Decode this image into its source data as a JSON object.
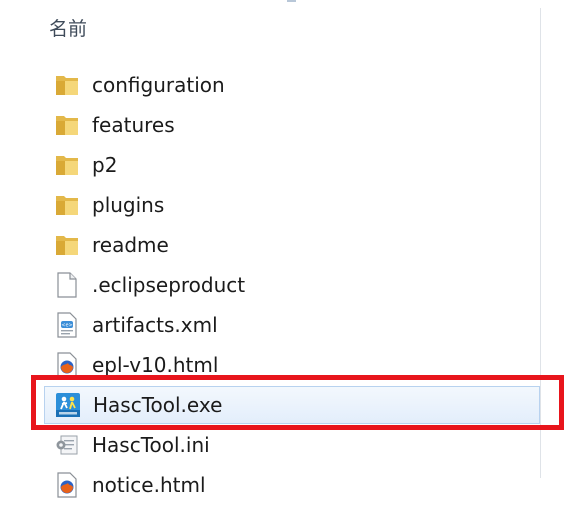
{
  "column_header": "名前",
  "files": [
    {
      "name": "configuration",
      "icon": "folder-icon"
    },
    {
      "name": "features",
      "icon": "folder-icon"
    },
    {
      "name": "p2",
      "icon": "folder-icon"
    },
    {
      "name": "plugins",
      "icon": "folder-icon"
    },
    {
      "name": "readme",
      "icon": "folder-icon"
    },
    {
      "name": ".eclipseproduct",
      "icon": "blank-file-icon"
    },
    {
      "name": "artifacts.xml",
      "icon": "xml-file-icon"
    },
    {
      "name": "epl-v10.html",
      "icon": "html-file-icon"
    },
    {
      "name": "HascTool.exe",
      "icon": "exe-app-icon",
      "selected": true
    },
    {
      "name": "HascTool.ini",
      "icon": "ini-settings-icon"
    },
    {
      "name": "notice.html",
      "icon": "html-file-icon"
    }
  ],
  "colors": {
    "highlight_box": "#e8151c",
    "folder": "#e8c25a",
    "selection": "#e3eefb"
  }
}
